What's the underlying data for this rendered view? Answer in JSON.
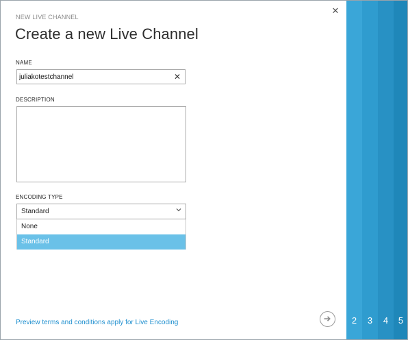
{
  "dialog": {
    "eyebrow": "NEW LIVE CHANNEL",
    "title": "Create a new Live Channel",
    "close_glyph": "✕"
  },
  "form": {
    "name_label": "NAME",
    "name_value": "juliakotestchannel",
    "clear_glyph": "✕",
    "description_label": "DESCRIPTION",
    "description_value": "",
    "encoding_label": "ENCODING TYPE",
    "encoding_selected": "Standard",
    "encoding_options": [
      "None",
      "Standard"
    ]
  },
  "footer": {
    "preview_link": "Preview terms and conditions apply for Live Encoding",
    "next_icon": "arrow-right-circle-icon"
  },
  "steps": [
    "2",
    "3",
    "4",
    "5"
  ],
  "colors": {
    "step2": "#3aa6d8",
    "step3": "#2f9ccf",
    "step4": "#2891c4",
    "step5": "#1f87b9",
    "selected_option": "#6ac1e8",
    "link": "#1f8fcf"
  }
}
